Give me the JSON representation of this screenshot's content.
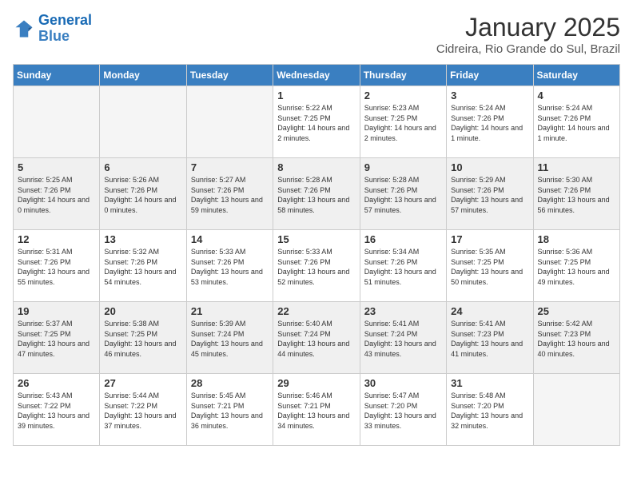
{
  "header": {
    "logo_text_general": "General",
    "logo_text_blue": "Blue",
    "title": "January 2025",
    "subtitle": "Cidreira, Rio Grande do Sul, Brazil"
  },
  "calendar": {
    "days_of_week": [
      "Sunday",
      "Monday",
      "Tuesday",
      "Wednesday",
      "Thursday",
      "Friday",
      "Saturday"
    ],
    "weeks": [
      {
        "row_style": "row-white",
        "days": [
          {
            "num": "",
            "info": "",
            "empty": true
          },
          {
            "num": "",
            "info": "",
            "empty": true
          },
          {
            "num": "",
            "info": "",
            "empty": true
          },
          {
            "num": "1",
            "info": "Sunrise: 5:22 AM\nSunset: 7:25 PM\nDaylight: 14 hours and 2 minutes.",
            "empty": false
          },
          {
            "num": "2",
            "info": "Sunrise: 5:23 AM\nSunset: 7:25 PM\nDaylight: 14 hours and 2 minutes.",
            "empty": false
          },
          {
            "num": "3",
            "info": "Sunrise: 5:24 AM\nSunset: 7:26 PM\nDaylight: 14 hours and 1 minute.",
            "empty": false
          },
          {
            "num": "4",
            "info": "Sunrise: 5:24 AM\nSunset: 7:26 PM\nDaylight: 14 hours and 1 minute.",
            "empty": false
          }
        ]
      },
      {
        "row_style": "row-gray",
        "days": [
          {
            "num": "5",
            "info": "Sunrise: 5:25 AM\nSunset: 7:26 PM\nDaylight: 14 hours and 0 minutes.",
            "empty": false
          },
          {
            "num": "6",
            "info": "Sunrise: 5:26 AM\nSunset: 7:26 PM\nDaylight: 14 hours and 0 minutes.",
            "empty": false
          },
          {
            "num": "7",
            "info": "Sunrise: 5:27 AM\nSunset: 7:26 PM\nDaylight: 13 hours and 59 minutes.",
            "empty": false
          },
          {
            "num": "8",
            "info": "Sunrise: 5:28 AM\nSunset: 7:26 PM\nDaylight: 13 hours and 58 minutes.",
            "empty": false
          },
          {
            "num": "9",
            "info": "Sunrise: 5:28 AM\nSunset: 7:26 PM\nDaylight: 13 hours and 57 minutes.",
            "empty": false
          },
          {
            "num": "10",
            "info": "Sunrise: 5:29 AM\nSunset: 7:26 PM\nDaylight: 13 hours and 57 minutes.",
            "empty": false
          },
          {
            "num": "11",
            "info": "Sunrise: 5:30 AM\nSunset: 7:26 PM\nDaylight: 13 hours and 56 minutes.",
            "empty": false
          }
        ]
      },
      {
        "row_style": "row-white",
        "days": [
          {
            "num": "12",
            "info": "Sunrise: 5:31 AM\nSunset: 7:26 PM\nDaylight: 13 hours and 55 minutes.",
            "empty": false
          },
          {
            "num": "13",
            "info": "Sunrise: 5:32 AM\nSunset: 7:26 PM\nDaylight: 13 hours and 54 minutes.",
            "empty": false
          },
          {
            "num": "14",
            "info": "Sunrise: 5:33 AM\nSunset: 7:26 PM\nDaylight: 13 hours and 53 minutes.",
            "empty": false
          },
          {
            "num": "15",
            "info": "Sunrise: 5:33 AM\nSunset: 7:26 PM\nDaylight: 13 hours and 52 minutes.",
            "empty": false
          },
          {
            "num": "16",
            "info": "Sunrise: 5:34 AM\nSunset: 7:26 PM\nDaylight: 13 hours and 51 minutes.",
            "empty": false
          },
          {
            "num": "17",
            "info": "Sunrise: 5:35 AM\nSunset: 7:25 PM\nDaylight: 13 hours and 50 minutes.",
            "empty": false
          },
          {
            "num": "18",
            "info": "Sunrise: 5:36 AM\nSunset: 7:25 PM\nDaylight: 13 hours and 49 minutes.",
            "empty": false
          }
        ]
      },
      {
        "row_style": "row-gray",
        "days": [
          {
            "num": "19",
            "info": "Sunrise: 5:37 AM\nSunset: 7:25 PM\nDaylight: 13 hours and 47 minutes.",
            "empty": false
          },
          {
            "num": "20",
            "info": "Sunrise: 5:38 AM\nSunset: 7:25 PM\nDaylight: 13 hours and 46 minutes.",
            "empty": false
          },
          {
            "num": "21",
            "info": "Sunrise: 5:39 AM\nSunset: 7:24 PM\nDaylight: 13 hours and 45 minutes.",
            "empty": false
          },
          {
            "num": "22",
            "info": "Sunrise: 5:40 AM\nSunset: 7:24 PM\nDaylight: 13 hours and 44 minutes.",
            "empty": false
          },
          {
            "num": "23",
            "info": "Sunrise: 5:41 AM\nSunset: 7:24 PM\nDaylight: 13 hours and 43 minutes.",
            "empty": false
          },
          {
            "num": "24",
            "info": "Sunrise: 5:41 AM\nSunset: 7:23 PM\nDaylight: 13 hours and 41 minutes.",
            "empty": false
          },
          {
            "num": "25",
            "info": "Sunrise: 5:42 AM\nSunset: 7:23 PM\nDaylight: 13 hours and 40 minutes.",
            "empty": false
          }
        ]
      },
      {
        "row_style": "row-white",
        "days": [
          {
            "num": "26",
            "info": "Sunrise: 5:43 AM\nSunset: 7:22 PM\nDaylight: 13 hours and 39 minutes.",
            "empty": false
          },
          {
            "num": "27",
            "info": "Sunrise: 5:44 AM\nSunset: 7:22 PM\nDaylight: 13 hours and 37 minutes.",
            "empty": false
          },
          {
            "num": "28",
            "info": "Sunrise: 5:45 AM\nSunset: 7:21 PM\nDaylight: 13 hours and 36 minutes.",
            "empty": false
          },
          {
            "num": "29",
            "info": "Sunrise: 5:46 AM\nSunset: 7:21 PM\nDaylight: 13 hours and 34 minutes.",
            "empty": false
          },
          {
            "num": "30",
            "info": "Sunrise: 5:47 AM\nSunset: 7:20 PM\nDaylight: 13 hours and 33 minutes.",
            "empty": false
          },
          {
            "num": "31",
            "info": "Sunrise: 5:48 AM\nSunset: 7:20 PM\nDaylight: 13 hours and 32 minutes.",
            "empty": false
          },
          {
            "num": "",
            "info": "",
            "empty": true
          }
        ]
      }
    ]
  }
}
